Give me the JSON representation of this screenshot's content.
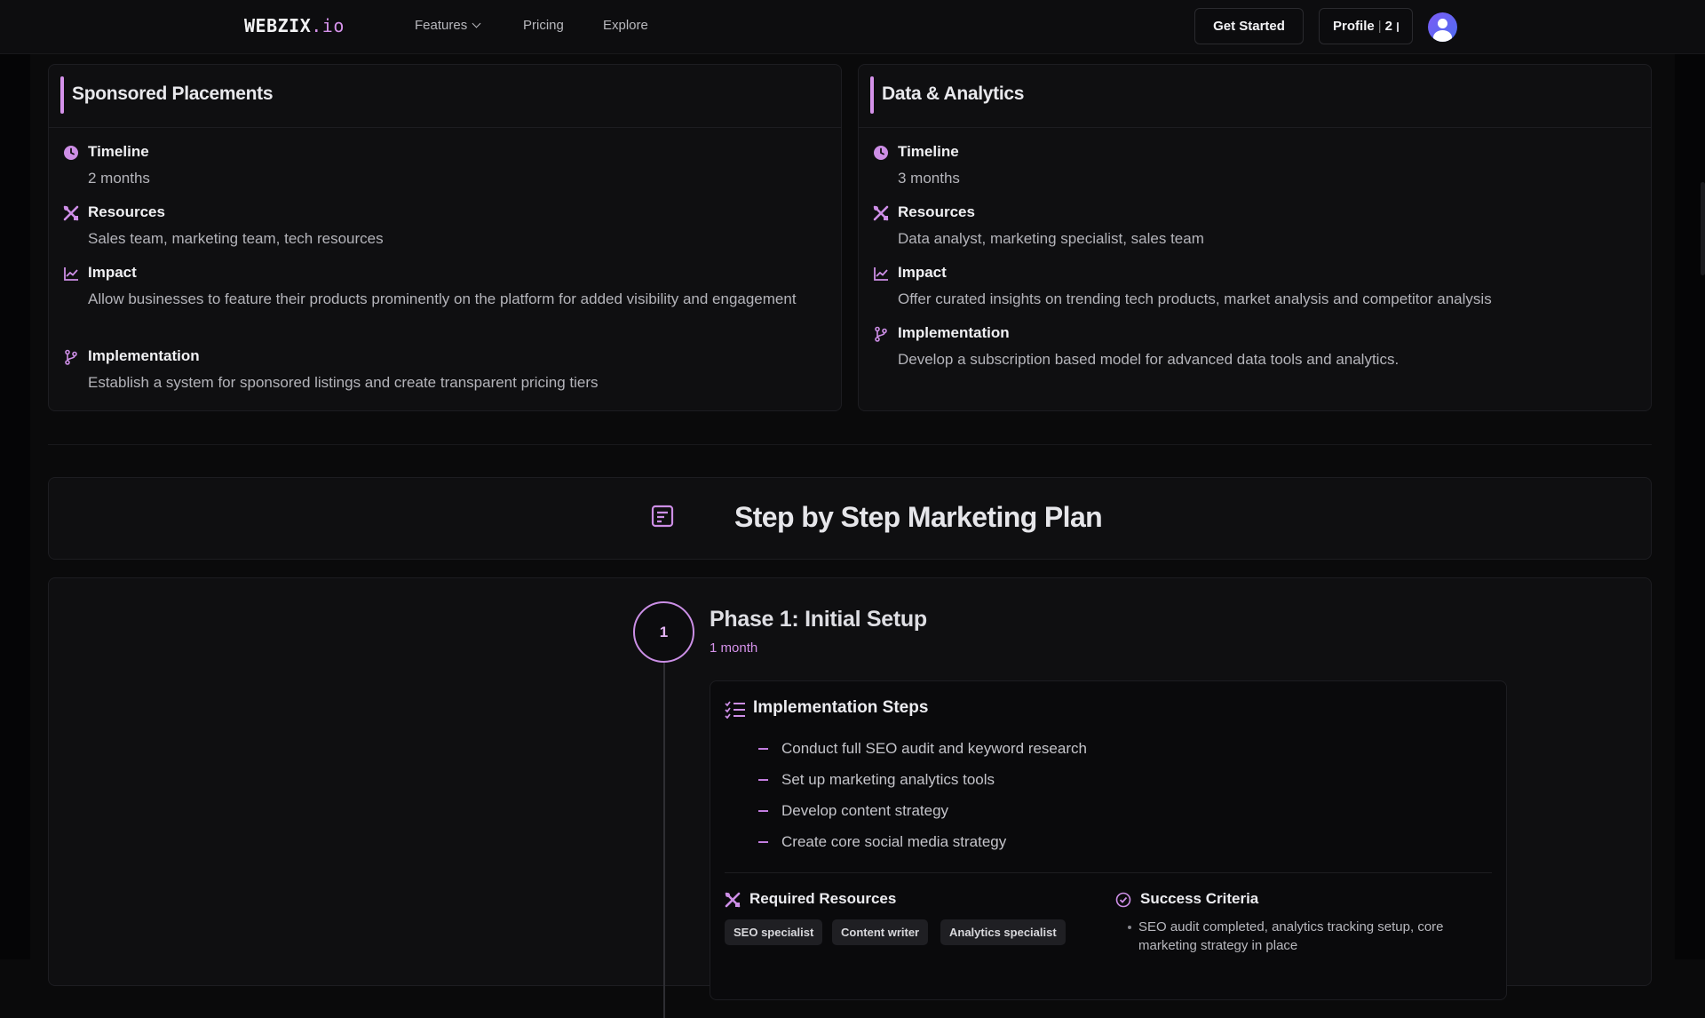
{
  "nav": {
    "logo_main": "WEBZIX",
    "logo_accent": ".io",
    "links": [
      "Features",
      "Pricing",
      "Explore"
    ],
    "get_started": "Get Started",
    "profile_label": "Profile",
    "profile_sep": "|",
    "profile_count": "2"
  },
  "cards": [
    {
      "title": "Sponsored Placements",
      "items": [
        {
          "label": "Timeline",
          "text": "2 months",
          "icon": "clock-icon"
        },
        {
          "label": "Resources",
          "text": "Sales team, marketing team, tech resources",
          "icon": "tools-icon"
        },
        {
          "label": "Impact",
          "text": "Allow businesses to feature their products prominently on the platform for added visibility and engagement",
          "icon": "chart-icon"
        },
        {
          "label": "Implementation",
          "text": "Establish a system for sponsored listings and create transparent pricing tiers",
          "icon": "branch-icon"
        }
      ]
    },
    {
      "title": "Data & Analytics",
      "items": [
        {
          "label": "Timeline",
          "text": "3 months",
          "icon": "clock-icon"
        },
        {
          "label": "Resources",
          "text": "Data analyst, marketing specialist, sales team",
          "icon": "tools-icon"
        },
        {
          "label": "Impact",
          "text": "Offer curated insights on trending tech products, market analysis and competitor analysis",
          "icon": "chart-icon"
        },
        {
          "label": "Implementation",
          "text": "Develop a subscription based model for advanced data tools and analytics.",
          "icon": "branch-icon"
        }
      ]
    }
  ],
  "plan": {
    "title": "Step by Step Marketing Plan"
  },
  "phase": {
    "number": "1",
    "title": "Phase 1: Initial Setup",
    "duration": "1 month",
    "steps_title": "Implementation Steps",
    "steps": [
      "Conduct full SEO audit and keyword research",
      "Set up marketing analytics tools",
      "Develop content strategy",
      "Create core social media strategy"
    ],
    "resources_title": "Required Resources",
    "resources": [
      "SEO specialist",
      "Content writer",
      "Analytics specialist"
    ],
    "criteria_title": "Success Criteria",
    "criteria": [
      "SEO audit completed, analytics tracking setup, core marketing strategy in place"
    ]
  },
  "colors": {
    "accent": "#d592ea",
    "background": "#0a0a0b",
    "card": "#0f0f11"
  }
}
